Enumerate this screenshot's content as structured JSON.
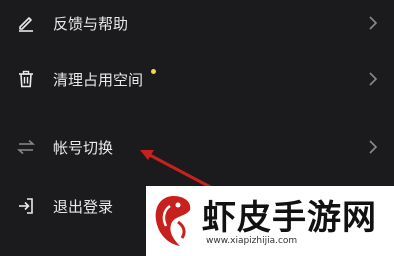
{
  "menu": {
    "items": [
      {
        "label": "反馈与帮助",
        "icon": "edit-icon"
      },
      {
        "label": "清理占用空间",
        "icon": "trash-icon",
        "badge": "new-dot"
      },
      {
        "label": "帐号切换",
        "icon": "switch-arrows-icon"
      },
      {
        "label": "退出登录",
        "icon": "logout-icon"
      }
    ]
  },
  "watermark": {
    "brand": "虾皮手游网",
    "url": "www.xiapizhijia.com"
  },
  "colors": {
    "background": "#1b1b1d",
    "text": "#e9e9ea",
    "badge": "#f3d54a",
    "arrow": "#c8201c"
  }
}
